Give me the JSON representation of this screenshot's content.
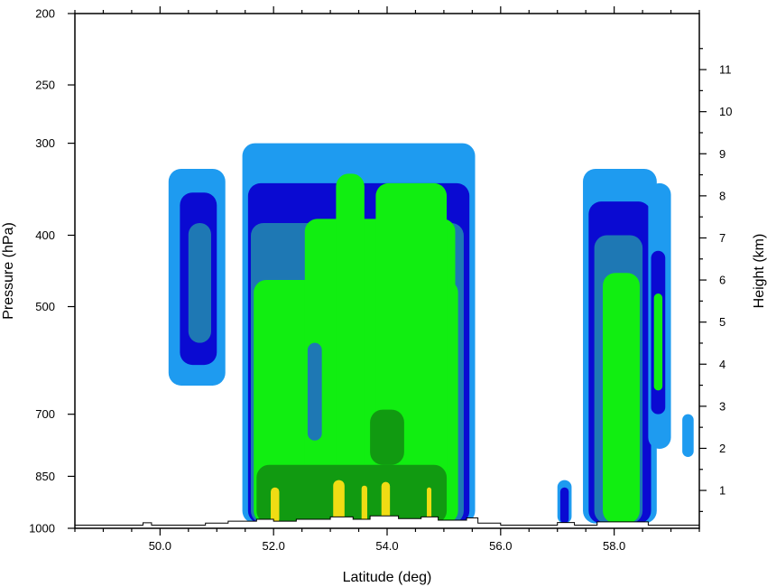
{
  "chart_data": {
    "type": "heatmap",
    "title": "",
    "xlabel": "Latitude (deg)",
    "ylabel_left": "Pressure (hPa)",
    "ylabel_right": "Height (km)",
    "xlim": [
      48.5,
      59.5
    ],
    "x_ticks": [
      50,
      52,
      54,
      56,
      58
    ],
    "x_tick_labels": [
      "50.0",
      "52.0",
      "54.0",
      "56.0",
      "58.0"
    ],
    "y_scale": "log",
    "ylim": [
      1000,
      200
    ],
    "y_ticks": [
      200,
      250,
      300,
      400,
      500,
      700,
      850,
      1000
    ],
    "y_tick_labels": [
      "200",
      "250",
      "300",
      "400",
      "500",
      "700",
      "850",
      "1000"
    ],
    "height_ticks_km": [
      1,
      2,
      3,
      4,
      5,
      6,
      7,
      8,
      9,
      10,
      11
    ],
    "height_tick_labels": [
      "1",
      "2",
      "3",
      "4",
      "5",
      "6",
      "7",
      "8",
      "9",
      "10",
      "11"
    ],
    "grid": false,
    "legend": "none",
    "levels": [
      {
        "level": 1,
        "color": "#1e9bf0"
      },
      {
        "level": 2,
        "color": "#0a0ad2"
      },
      {
        "level": 3,
        "color": "#1e78b4"
      },
      {
        "level": 4,
        "color": "#11ee11"
      },
      {
        "level": 5,
        "color": "#119a11"
      },
      {
        "level": 6,
        "color": "#f0dc14"
      }
    ],
    "cells": [
      {
        "lat_from": 50.15,
        "lat_to": 51.15,
        "p_top": 325,
        "p_bottom": 640,
        "level": 1
      },
      {
        "lat_from": 50.35,
        "lat_to": 51.0,
        "p_top": 350,
        "p_bottom": 600,
        "level": 2
      },
      {
        "lat_from": 50.5,
        "lat_to": 50.9,
        "p_top": 385,
        "p_bottom": 560,
        "level": 3
      },
      {
        "lat_from": 51.45,
        "lat_to": 55.55,
        "p_top": 300,
        "p_bottom": 985,
        "level": 1
      },
      {
        "lat_from": 51.55,
        "lat_to": 55.45,
        "p_top": 340,
        "p_bottom": 985,
        "level": 2
      },
      {
        "lat_from": 51.6,
        "lat_to": 55.35,
        "p_top": 385,
        "p_bottom": 985,
        "level": 3
      },
      {
        "lat_from": 51.65,
        "lat_to": 55.25,
        "p_top": 460,
        "p_bottom": 985,
        "level": 4
      },
      {
        "lat_from": 52.55,
        "lat_to": 55.2,
        "p_top": 380,
        "p_bottom": 985,
        "level": 4
      },
      {
        "lat_from": 53.1,
        "lat_to": 53.6,
        "p_top": 330,
        "p_bottom": 985,
        "level": 4
      },
      {
        "lat_from": 53.8,
        "lat_to": 55.05,
        "p_top": 340,
        "p_bottom": 985,
        "level": 4
      },
      {
        "lat_from": 52.6,
        "lat_to": 52.85,
        "p_top": 560,
        "p_bottom": 760,
        "level": 3
      },
      {
        "lat_from": 51.7,
        "lat_to": 55.05,
        "p_top": 820,
        "p_bottom": 985,
        "level": 5
      },
      {
        "lat_from": 53.7,
        "lat_to": 54.3,
        "p_top": 690,
        "p_bottom": 820,
        "level": 5
      },
      {
        "lat_from": 51.95,
        "lat_to": 52.1,
        "p_top": 880,
        "p_bottom": 985,
        "level": 6
      },
      {
        "lat_from": 53.05,
        "lat_to": 53.25,
        "p_top": 860,
        "p_bottom": 985,
        "level": 6
      },
      {
        "lat_from": 53.55,
        "lat_to": 53.65,
        "p_top": 875,
        "p_bottom": 985,
        "level": 6
      },
      {
        "lat_from": 53.9,
        "lat_to": 54.05,
        "p_top": 865,
        "p_bottom": 985,
        "level": 6
      },
      {
        "lat_from": 54.7,
        "lat_to": 54.78,
        "p_top": 880,
        "p_bottom": 985,
        "level": 6
      },
      {
        "lat_from": 57.0,
        "lat_to": 57.25,
        "p_top": 860,
        "p_bottom": 985,
        "level": 1
      },
      {
        "lat_from": 57.05,
        "lat_to": 57.2,
        "p_top": 880,
        "p_bottom": 985,
        "level": 2
      },
      {
        "lat_from": 57.45,
        "lat_to": 58.75,
        "p_top": 325,
        "p_bottom": 985,
        "level": 1
      },
      {
        "lat_from": 57.55,
        "lat_to": 58.65,
        "p_top": 360,
        "p_bottom": 985,
        "level": 2
      },
      {
        "lat_from": 57.65,
        "lat_to": 58.5,
        "p_top": 400,
        "p_bottom": 985,
        "level": 3
      },
      {
        "lat_from": 57.8,
        "lat_to": 58.45,
        "p_top": 450,
        "p_bottom": 985,
        "level": 4
      },
      {
        "lat_from": 58.6,
        "lat_to": 59.0,
        "p_top": 340,
        "p_bottom": 780,
        "level": 1
      },
      {
        "lat_from": 58.65,
        "lat_to": 58.9,
        "p_top": 420,
        "p_bottom": 700,
        "level": 2
      },
      {
        "lat_from": 58.7,
        "lat_to": 58.85,
        "p_top": 480,
        "p_bottom": 650,
        "level": 4
      },
      {
        "lat_from": 59.2,
        "lat_to": 59.4,
        "p_top": 700,
        "p_bottom": 800,
        "level": 1
      }
    ],
    "terrain": [
      {
        "lat": 48.5,
        "p": 990
      },
      {
        "lat": 49.7,
        "p": 990
      },
      {
        "lat": 49.7,
        "p": 983
      },
      {
        "lat": 49.85,
        "p": 983
      },
      {
        "lat": 49.85,
        "p": 990
      },
      {
        "lat": 50.8,
        "p": 990
      },
      {
        "lat": 50.8,
        "p": 984
      },
      {
        "lat": 51.2,
        "p": 984
      },
      {
        "lat": 51.2,
        "p": 978
      },
      {
        "lat": 51.7,
        "p": 978
      },
      {
        "lat": 51.7,
        "p": 972
      },
      {
        "lat": 52.0,
        "p": 972
      },
      {
        "lat": 52.0,
        "p": 978
      },
      {
        "lat": 52.4,
        "p": 978
      },
      {
        "lat": 52.4,
        "p": 972
      },
      {
        "lat": 53.0,
        "p": 972
      },
      {
        "lat": 53.0,
        "p": 965
      },
      {
        "lat": 53.4,
        "p": 965
      },
      {
        "lat": 53.4,
        "p": 972
      },
      {
        "lat": 53.7,
        "p": 972
      },
      {
        "lat": 53.7,
        "p": 962
      },
      {
        "lat": 54.2,
        "p": 962
      },
      {
        "lat": 54.2,
        "p": 970
      },
      {
        "lat": 54.6,
        "p": 970
      },
      {
        "lat": 54.6,
        "p": 965
      },
      {
        "lat": 54.9,
        "p": 965
      },
      {
        "lat": 54.9,
        "p": 975
      },
      {
        "lat": 55.4,
        "p": 975
      },
      {
        "lat": 55.4,
        "p": 968
      },
      {
        "lat": 55.6,
        "p": 968
      },
      {
        "lat": 55.6,
        "p": 984
      },
      {
        "lat": 56.0,
        "p": 984
      },
      {
        "lat": 56.0,
        "p": 990
      },
      {
        "lat": 57.0,
        "p": 990
      },
      {
        "lat": 57.0,
        "p": 982
      },
      {
        "lat": 57.3,
        "p": 982
      },
      {
        "lat": 57.3,
        "p": 990
      },
      {
        "lat": 57.7,
        "p": 990
      },
      {
        "lat": 57.7,
        "p": 980
      },
      {
        "lat": 58.6,
        "p": 980
      },
      {
        "lat": 58.6,
        "p": 990
      },
      {
        "lat": 59.5,
        "p": 990
      }
    ]
  }
}
